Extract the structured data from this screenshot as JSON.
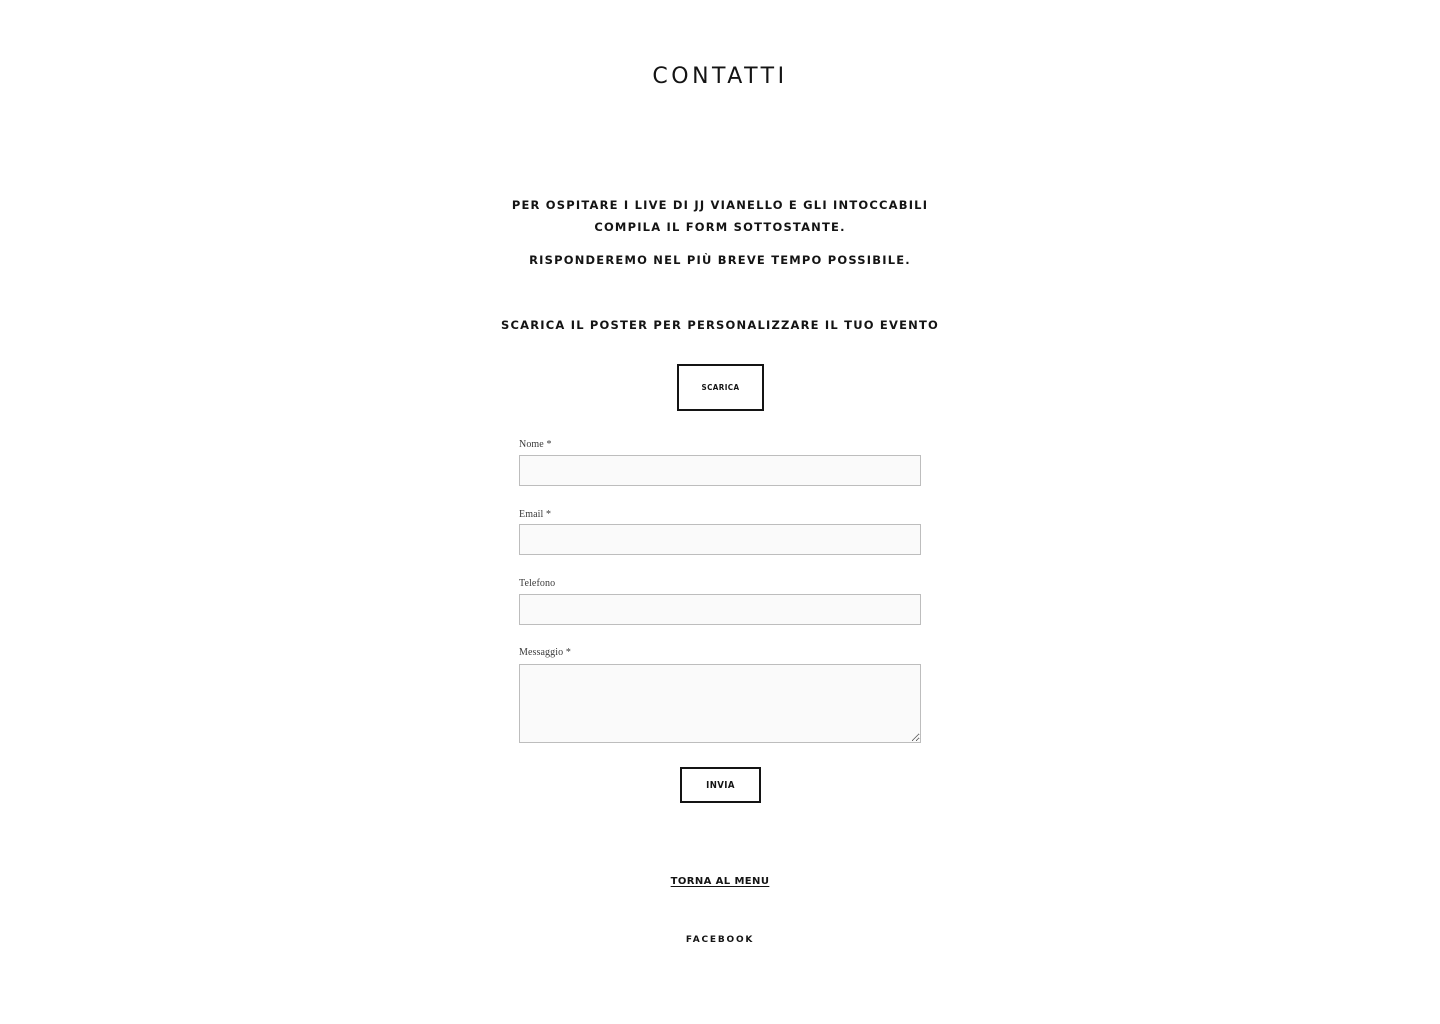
{
  "header": {
    "title": "CONTATTI"
  },
  "intro": {
    "line1": "PER OSPITARE I LIVE DI JJ VIANELLO E GLI INTOCCABILI",
    "line2": "COMPILA IL FORM SOTTOSTANTE.",
    "line3": "RISPONDEREMO NEL PIÙ BREVE TEMPO POSSIBILE."
  },
  "poster": {
    "heading": "SCARICA IL POSTER PER PERSONALIZZARE IL TUO EVENTO",
    "button_label": "SCARICA"
  },
  "form": {
    "name_label": "Nome *",
    "name_value": "",
    "email_label": "Email *",
    "email_value": "",
    "phone_label": "Telefono",
    "phone_value": "",
    "message_label": "Messaggio *",
    "message_value": "",
    "submit_label": "INVIA"
  },
  "footer": {
    "back_link": "TORNA AL MENU",
    "facebook_link": "FACEBOOK"
  }
}
